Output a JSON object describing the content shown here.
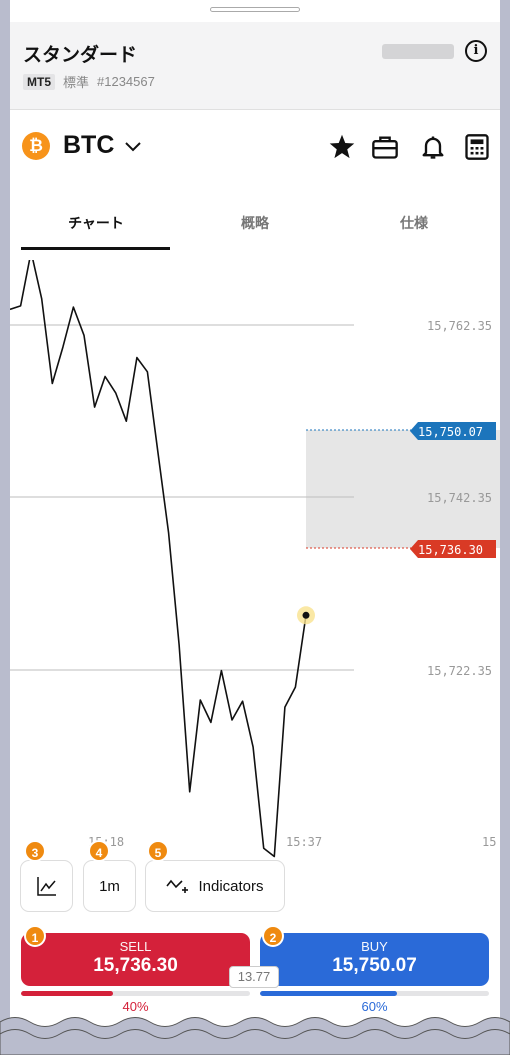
{
  "account": {
    "title": "スタンダード",
    "platform": "MT5",
    "type": "標準",
    "number": "#1234567"
  },
  "symbol": {
    "name": "BTC",
    "coin_glyph": "₿",
    "coin_color": "#f7931a"
  },
  "header_icons": [
    "info-icon"
  ],
  "symbol_icons": [
    "star-icon",
    "briefcase-icon",
    "bell-icon",
    "calculator-icon"
  ],
  "tabs": [
    {
      "label": "チャート",
      "active": true
    },
    {
      "label": "概略",
      "active": false
    },
    {
      "label": "仕様",
      "active": false
    }
  ],
  "chart_data": {
    "type": "line",
    "price_labels": [
      "15,762.35",
      "15,742.35",
      "15,722.35"
    ],
    "time_labels": [
      "15:18",
      "15:37",
      "15"
    ],
    "ask_label": "15,750.07",
    "bid_label": "15,736.30",
    "ask_color": "#1c75bc",
    "bid_color": "#d93a25",
    "y_range": [
      15715.5,
      15766.5
    ],
    "series": [
      {
        "values": [
          15762.3,
          15762.6,
          15767.2,
          15763.2,
          15756.0,
          15759.1,
          15762.5,
          15760.1,
          15754.0,
          15756.6,
          15755.2,
          15752.8,
          15758.2,
          15757.0,
          15750.1,
          15743.3,
          15733.8,
          15721.3,
          15729.1,
          15727.2,
          15731.6,
          15727.4,
          15729.0,
          15725.1,
          15716.5,
          15715.8,
          15728.5,
          15730.2,
          15736.3
        ]
      }
    ]
  },
  "controls": {
    "indicators_label": "Indicators",
    "timeframe_label": "1m",
    "badges": [
      "3",
      "4",
      "5"
    ]
  },
  "trade": {
    "sell_label": "SELL",
    "sell_price": "15,736.30",
    "buy_label": "BUY",
    "buy_price": "15,750.07",
    "spread": "13.77",
    "sell_badge": "1",
    "buy_badge": "2",
    "sell_pct_label": "40%",
    "buy_pct_label": "60%",
    "sell_pct": 0.4,
    "buy_pct": 0.6,
    "sell_color": "#d4213a",
    "buy_color": "#2a6ad8"
  }
}
